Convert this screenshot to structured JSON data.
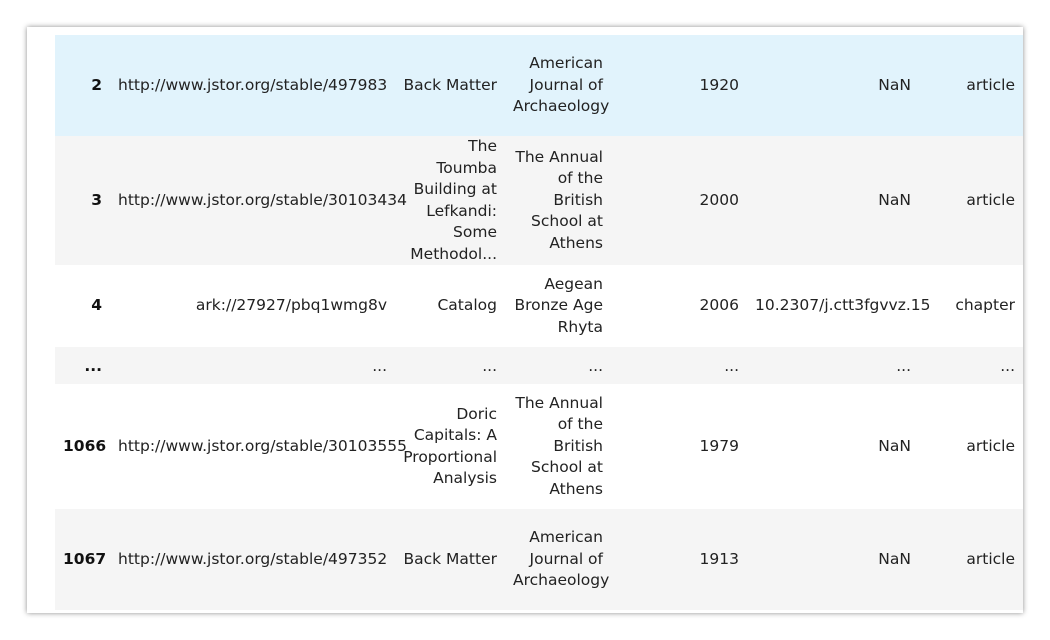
{
  "table": {
    "rows": [
      {
        "index": "2",
        "url": "http://www.jstor.org/stable/497983",
        "title": "Back Matter",
        "journal": "American Journal of Archaeology",
        "year": "1920",
        "doi": "NaN",
        "type": "article",
        "state": "hover"
      },
      {
        "index": "3",
        "url": "http://www.jstor.org/stable/30103434",
        "title": "The Toumba Building at Lefkandi: Some Methodol...",
        "journal": "The Annual of the British School at Athens",
        "year": "2000",
        "doi": "NaN",
        "type": "article",
        "state": "even"
      },
      {
        "index": "4",
        "url": "ark://27927/pbq1wmg8v",
        "title": "Catalog",
        "journal": "Aegean Bronze Age Rhyta",
        "year": "2006",
        "doi": "10.2307/j.ctt3fgvvz.15",
        "type": "chapter",
        "state": "odd"
      },
      {
        "index": "...",
        "url": "...",
        "title": "...",
        "journal": "...",
        "year": "...",
        "doi": "...",
        "type": "...",
        "state": "even"
      },
      {
        "index": "1066",
        "url": "http://www.jstor.org/stable/30103555",
        "title": "Doric Capitals: A Proportional Analysis",
        "journal": "The Annual of the British School at Athens",
        "year": "1979",
        "doi": "NaN",
        "type": "article",
        "state": "odd"
      },
      {
        "index": "1067",
        "url": "http://www.jstor.org/stable/497352",
        "title": "Back Matter",
        "journal": "American Journal of Archaeology",
        "year": "1913",
        "doi": "NaN",
        "type": "article",
        "state": "even"
      }
    ]
  },
  "colors": {
    "hover_row": "#e1f3fc",
    "striped_row": "#f5f5f5",
    "plain_row": "#ffffff",
    "text": "#222222"
  }
}
